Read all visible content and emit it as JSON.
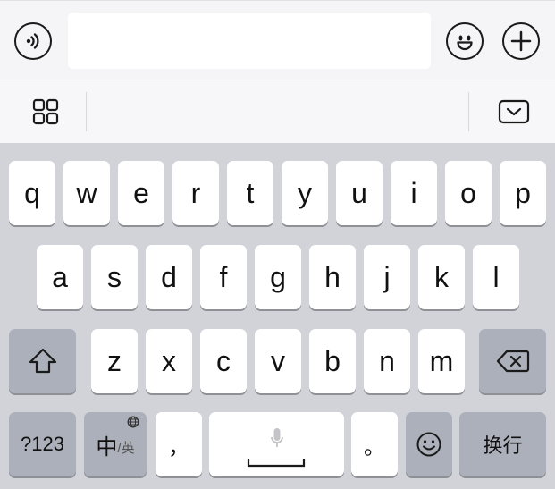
{
  "chat_input": {
    "value": "",
    "placeholder": ""
  },
  "keyboard": {
    "row1": [
      "q",
      "w",
      "e",
      "r",
      "t",
      "y",
      "u",
      "i",
      "o",
      "p"
    ],
    "row2": [
      "a",
      "s",
      "d",
      "f",
      "g",
      "h",
      "j",
      "k",
      "l"
    ],
    "row3": [
      "z",
      "x",
      "c",
      "v",
      "b",
      "n",
      "m"
    ],
    "numbers_label": "?123",
    "lang_main": "中",
    "lang_alt": "/英",
    "comma_label": "，",
    "period_label": "。",
    "return_label": "换行"
  },
  "colors": {
    "key": "#ffffff",
    "special_key": "#abb0ba",
    "keyboard_bg": "#d2d3d9"
  }
}
